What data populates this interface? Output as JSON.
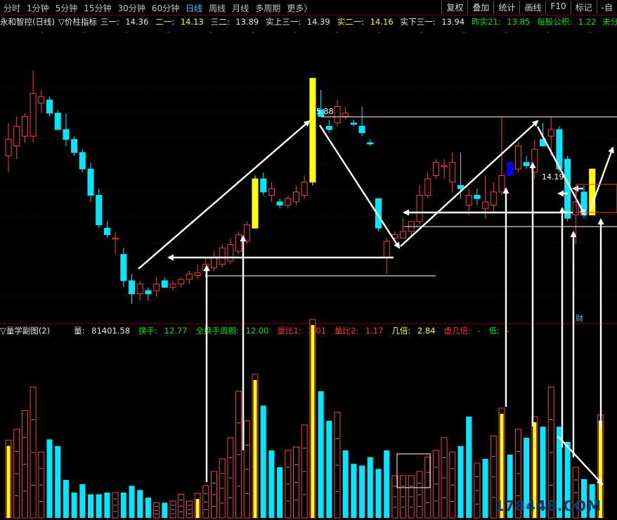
{
  "toolbar": {
    "tabs": [
      "分时",
      "1分钟",
      "5分钟",
      "15分钟",
      "30分钟",
      "60分钟",
      "日线",
      "周线",
      "月线",
      "多周期",
      "更多〉"
    ],
    "active_tab": "日线",
    "tools": [
      "复权",
      "叠加",
      "统计",
      "画线",
      "F10",
      "标记",
      "-自"
    ]
  },
  "price_header": {
    "name": "永和智控(日线)",
    "indicator": "▽价柱指标",
    "san_yi_label": "三一:",
    "san_yi": "14.36",
    "er_yi_label": "二一:",
    "er_yi": "14.13",
    "san_er_label": "三二:",
    "san_er": "13.89",
    "shi_shang_label": "实上三一:",
    "shi_shang": "14.39",
    "shi_er_label": "实二一:",
    "shi_er": "14.16",
    "shi_xia_label": "实下三一:",
    "shi_xia": "13.94",
    "zuo_shi_label": "昨实21:",
    "zuo_shi": "13.85",
    "gongji_label": "每股公积:",
    "gongji": "1.22",
    "fenli": "未分利"
  },
  "volume_header": {
    "name": "▽量学副图(2)",
    "liang_label": "量:",
    "liang": "81401.58",
    "huanshou_label": "换手:",
    "huanshou": "12.77",
    "quan_label": "全换手周期:",
    "quan": "12.00",
    "lb1_label": "量比1:",
    "lb1": "2.01",
    "lb2_label": "量比2:",
    "lb2": "1.17",
    "jibei_label": "几倍:",
    "jibei": "2.84",
    "xubei_label": "虚几倍:",
    "xubei": "-",
    "di_label": "低:",
    "di": "-"
  },
  "chart_data": {
    "type": "candlestick",
    "annotations": {
      "high": "15.88",
      "mark": "14.19",
      "fin_marker": "财"
    },
    "colors": {
      "up": "#ff3c3c",
      "down": "#00e8ff",
      "special": "#ffff00",
      "blue": "#0000ff"
    },
    "price_range": [
      12.2,
      16.6
    ],
    "candles": [
      {
        "o": 14.7,
        "h": 15.2,
        "l": 14.45,
        "c": 14.95,
        "t": "up"
      },
      {
        "o": 14.85,
        "h": 15.3,
        "l": 14.65,
        "c": 15.15,
        "t": "up"
      },
      {
        "o": 15.0,
        "h": 15.35,
        "l": 14.9,
        "c": 15.3,
        "t": "up"
      },
      {
        "o": 15.0,
        "h": 16.0,
        "l": 14.9,
        "c": 15.65,
        "t": "up"
      },
      {
        "o": 15.5,
        "h": 15.7,
        "l": 15.35,
        "c": 15.6,
        "t": "up"
      },
      {
        "o": 15.55,
        "h": 15.6,
        "l": 15.3,
        "c": 15.35,
        "t": "down"
      },
      {
        "o": 15.35,
        "h": 15.4,
        "l": 15.1,
        "c": 15.1,
        "t": "down"
      },
      {
        "o": 15.1,
        "h": 15.35,
        "l": 14.85,
        "c": 14.95,
        "t": "down"
      },
      {
        "o": 14.95,
        "h": 15.0,
        "l": 14.7,
        "c": 14.75,
        "t": "down"
      },
      {
        "o": 14.75,
        "h": 14.8,
        "l": 14.45,
        "c": 14.5,
        "t": "down"
      },
      {
        "o": 14.5,
        "h": 14.6,
        "l": 14.0,
        "c": 14.1,
        "t": "down"
      },
      {
        "o": 14.1,
        "h": 14.2,
        "l": 13.6,
        "c": 13.65,
        "t": "down"
      },
      {
        "o": 13.6,
        "h": 13.7,
        "l": 13.45,
        "c": 13.5,
        "t": "down"
      },
      {
        "o": 13.45,
        "h": 13.55,
        "l": 13.2,
        "c": 13.45,
        "t": "up"
      },
      {
        "o": 13.2,
        "h": 13.3,
        "l": 12.7,
        "c": 12.8,
        "t": "down"
      },
      {
        "o": 12.8,
        "h": 12.9,
        "l": 12.45,
        "c": 12.6,
        "t": "down"
      },
      {
        "o": 12.6,
        "h": 12.8,
        "l": 12.5,
        "c": 12.75,
        "t": "up"
      },
      {
        "o": 12.65,
        "h": 12.7,
        "l": 12.5,
        "c": 12.6,
        "t": "down"
      },
      {
        "o": 12.65,
        "h": 12.85,
        "l": 12.55,
        "c": 12.75,
        "t": "up"
      },
      {
        "o": 12.8,
        "h": 12.85,
        "l": 12.7,
        "c": 12.7,
        "t": "down"
      },
      {
        "o": 12.7,
        "h": 12.8,
        "l": 12.65,
        "c": 12.75,
        "t": "up"
      },
      {
        "o": 12.75,
        "h": 12.85,
        "l": 12.7,
        "c": 12.82,
        "t": "up"
      },
      {
        "o": 12.82,
        "h": 12.95,
        "l": 12.75,
        "c": 12.9,
        "t": "up"
      },
      {
        "o": 12.88,
        "h": 13.05,
        "l": 12.82,
        "c": 12.92,
        "t": "up"
      },
      {
        "o": 12.95,
        "h": 13.15,
        "l": 12.85,
        "c": 13.05,
        "t": "up"
      },
      {
        "o": 13.0,
        "h": 13.25,
        "l": 12.95,
        "c": 13.15,
        "t": "up"
      },
      {
        "o": 13.05,
        "h": 13.35,
        "l": 13.0,
        "c": 13.3,
        "t": "up"
      },
      {
        "o": 13.1,
        "h": 13.45,
        "l": 13.05,
        "c": 13.35,
        "t": "up"
      },
      {
        "o": 13.25,
        "h": 13.55,
        "l": 13.2,
        "c": 13.5,
        "t": "up"
      },
      {
        "o": 13.4,
        "h": 13.7,
        "l": 13.35,
        "c": 13.65,
        "t": "up"
      },
      {
        "o": 13.6,
        "h": 14.4,
        "l": 13.6,
        "c": 14.35,
        "t": "special"
      },
      {
        "o": 14.35,
        "h": 14.45,
        "l": 14.1,
        "c": 14.15,
        "t": "down"
      },
      {
        "o": 14.1,
        "h": 14.3,
        "l": 14.0,
        "c": 14.2,
        "t": "up"
      },
      {
        "o": 14.0,
        "h": 14.05,
        "l": 13.9,
        "c": 13.95,
        "t": "down"
      },
      {
        "o": 13.95,
        "h": 14.1,
        "l": 13.9,
        "c": 14.05,
        "t": "up"
      },
      {
        "o": 14.0,
        "h": 14.25,
        "l": 13.95,
        "c": 14.15,
        "t": "up"
      },
      {
        "o": 14.1,
        "h": 14.4,
        "l": 14.05,
        "c": 14.3,
        "t": "up"
      },
      {
        "o": 14.3,
        "h": 15.88,
        "l": 14.25,
        "c": 15.88,
        "t": "special"
      },
      {
        "o": 15.4,
        "h": 15.7,
        "l": 15.3,
        "c": 15.3,
        "t": "down"
      },
      {
        "o": 15.15,
        "h": 15.25,
        "l": 15.05,
        "c": 15.1,
        "t": "down"
      },
      {
        "o": 15.2,
        "h": 15.55,
        "l": 15.15,
        "c": 15.45,
        "t": "up"
      },
      {
        "o": 15.35,
        "h": 15.45,
        "l": 15.25,
        "c": 15.3,
        "t": "up"
      },
      {
        "o": 15.2,
        "h": 15.25,
        "l": 15.15,
        "c": 15.18,
        "t": "down"
      },
      {
        "o": 15.15,
        "h": 15.45,
        "l": 15.0,
        "c": 15.05,
        "t": "down"
      },
      {
        "o": 14.9,
        "h": 14.95,
        "l": 14.85,
        "c": 14.88,
        "t": "down"
      },
      {
        "o": 14.05,
        "h": 14.05,
        "l": 13.55,
        "c": 13.6,
        "t": "down"
      },
      {
        "o": 13.4,
        "h": 13.45,
        "l": 12.9,
        "c": 13.15,
        "t": "up"
      },
      {
        "o": 13.45,
        "h": 13.55,
        "l": 13.4,
        "c": 13.5,
        "t": "up"
      },
      {
        "o": 13.45,
        "h": 13.75,
        "l": 13.45,
        "c": 13.55,
        "t": "up"
      },
      {
        "o": 13.55,
        "h": 13.7,
        "l": 13.5,
        "c": 13.7,
        "t": "up"
      },
      {
        "o": 13.7,
        "h": 14.25,
        "l": 13.65,
        "c": 14.1,
        "t": "up"
      },
      {
        "o": 14.1,
        "h": 14.45,
        "l": 14.05,
        "c": 14.35,
        "t": "up"
      },
      {
        "o": 14.4,
        "h": 14.65,
        "l": 14.35,
        "c": 14.6,
        "t": "up"
      },
      {
        "o": 14.55,
        "h": 14.65,
        "l": 14.35,
        "c": 14.55,
        "t": "up"
      },
      {
        "o": 14.6,
        "h": 14.75,
        "l": 14.15,
        "c": 14.3,
        "t": "up"
      },
      {
        "o": 14.25,
        "h": 14.75,
        "l": 14.05,
        "c": 14.2,
        "t": "down"
      },
      {
        "o": 13.95,
        "h": 14.2,
        "l": 13.8,
        "c": 14.1,
        "t": "up"
      },
      {
        "o": 14.1,
        "h": 14.2,
        "l": 13.95,
        "c": 14.05,
        "t": "down"
      },
      {
        "o": 13.9,
        "h": 14.4,
        "l": 13.75,
        "c": 14.0,
        "t": "up"
      },
      {
        "o": 13.95,
        "h": 14.3,
        "l": 13.85,
        "c": 14.15,
        "t": "up"
      },
      {
        "o": 14.15,
        "h": 15.3,
        "l": 14.1,
        "c": 14.4,
        "t": "up"
      },
      {
        "o": 14.6,
        "h": 14.65,
        "l": 14.4,
        "c": 14.4,
        "t": "blue"
      },
      {
        "o": 14.5,
        "h": 14.9,
        "l": 14.45,
        "c": 14.85,
        "t": "up"
      },
      {
        "o": 14.6,
        "h": 14.7,
        "l": 14.5,
        "c": 14.55,
        "t": "down"
      },
      {
        "o": 14.45,
        "h": 14.95,
        "l": 14.35,
        "c": 14.8,
        "t": "up"
      },
      {
        "o": 14.95,
        "h": 15.2,
        "l": 14.85,
        "c": 14.85,
        "t": "down"
      },
      {
        "o": 15.0,
        "h": 15.3,
        "l": 14.7,
        "c": 15.1,
        "t": "up"
      },
      {
        "o": 15.1,
        "h": 15.15,
        "l": 14.45,
        "c": 14.5,
        "t": "down"
      },
      {
        "o": 14.65,
        "h": 14.7,
        "l": 13.7,
        "c": 13.75,
        "t": "down"
      },
      {
        "o": 13.8,
        "h": 14.2,
        "l": 13.35,
        "c": 14.0,
        "t": "up"
      },
      {
        "o": 14.15,
        "h": 14.25,
        "l": 13.75,
        "c": 13.8,
        "t": "down"
      },
      {
        "o": 13.8,
        "h": 14.5,
        "l": 13.8,
        "c": 14.5,
        "t": "special"
      }
    ],
    "volumes": [
      {
        "v": 92,
        "t": "special"
      },
      {
        "v": 105,
        "t": "up"
      },
      {
        "v": 127,
        "t": "up"
      },
      {
        "v": 155,
        "t": "up"
      },
      {
        "v": 78,
        "t": "up"
      },
      {
        "v": 93,
        "t": "down"
      },
      {
        "v": 85,
        "t": "down"
      },
      {
        "v": 45,
        "t": "down"
      },
      {
        "v": 30,
        "t": "down"
      },
      {
        "v": 40,
        "t": "down"
      },
      {
        "v": 28,
        "t": "down"
      },
      {
        "v": 28,
        "t": "down"
      },
      {
        "v": 30,
        "t": "down"
      },
      {
        "v": 30,
        "t": "up"
      },
      {
        "v": 30,
        "t": "down"
      },
      {
        "v": 38,
        "t": "down"
      },
      {
        "v": 33,
        "t": "down"
      },
      {
        "v": 24,
        "t": "down"
      },
      {
        "v": 18,
        "t": "up"
      },
      {
        "v": 18,
        "t": "down"
      },
      {
        "v": 20,
        "t": "up"
      },
      {
        "v": 28,
        "t": "up"
      },
      {
        "v": 20,
        "t": "up"
      },
      {
        "v": 29,
        "t": "special"
      },
      {
        "v": 38,
        "t": "up"
      },
      {
        "v": 55,
        "t": "up"
      },
      {
        "v": 70,
        "t": "up"
      },
      {
        "v": 95,
        "t": "up"
      },
      {
        "v": 150,
        "t": "up"
      },
      {
        "v": 115,
        "t": "up"
      },
      {
        "v": 170,
        "t": "special"
      },
      {
        "v": 133,
        "t": "down"
      },
      {
        "v": 80,
        "t": "down"
      },
      {
        "v": 60,
        "t": "down"
      },
      {
        "v": 80,
        "t": "up"
      },
      {
        "v": 84,
        "t": "up"
      },
      {
        "v": 110,
        "t": "up"
      },
      {
        "v": 235,
        "t": "special"
      },
      {
        "v": 150,
        "t": "down"
      },
      {
        "v": 115,
        "t": "down"
      },
      {
        "v": 125,
        "t": "up"
      },
      {
        "v": 80,
        "t": "down"
      },
      {
        "v": 64,
        "t": "down"
      },
      {
        "v": 62,
        "t": "down"
      },
      {
        "v": 72,
        "t": "down"
      },
      {
        "v": 58,
        "t": "down"
      },
      {
        "v": 80,
        "t": "down"
      },
      {
        "v": 50,
        "t": "up"
      },
      {
        "v": 50,
        "t": "up"
      },
      {
        "v": 50,
        "t": "up"
      },
      {
        "v": 55,
        "t": "up"
      },
      {
        "v": 72,
        "t": "up"
      },
      {
        "v": 80,
        "t": "up"
      },
      {
        "v": 95,
        "t": "up"
      },
      {
        "v": 78,
        "t": "up"
      },
      {
        "v": 85,
        "t": "down"
      },
      {
        "v": 120,
        "t": "down"
      },
      {
        "v": 65,
        "t": "up"
      },
      {
        "v": 70,
        "t": "down"
      },
      {
        "v": 97,
        "t": "up"
      },
      {
        "v": 130,
        "t": "special"
      },
      {
        "v": 75,
        "t": "down"
      },
      {
        "v": 105,
        "t": "up"
      },
      {
        "v": 95,
        "t": "down"
      },
      {
        "v": 120,
        "t": "special"
      },
      {
        "v": 108,
        "t": "down"
      },
      {
        "v": 155,
        "t": "up"
      },
      {
        "v": 108,
        "t": "down"
      },
      {
        "v": 90,
        "t": "down"
      },
      {
        "v": 60,
        "t": "up"
      },
      {
        "v": 46,
        "t": "down"
      },
      {
        "v": 40,
        "t": "down"
      },
      {
        "v": 122,
        "t": "special"
      }
    ]
  }
}
